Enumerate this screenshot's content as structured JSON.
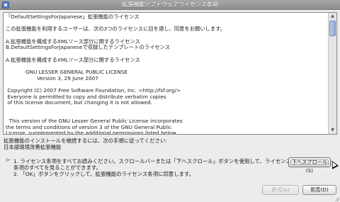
{
  "window": {
    "title": "拡張機能ソフトウェアライセンス条項"
  },
  "license": {
    "text_lines": [
      "「DefaultSettingsForJapanese」拡張機能のライセンス",
      "",
      "この拡張機能を利用するユーザーは、次の3つのライセンスに目を通し、同意をお願いします。",
      "",
      "A.拡張機能を構成するXMLソース部分に関するライセンス",
      "B.DefaultSettingsForJapaneseで収録したテンプレートのライセンス",
      "",
      "A.拡張機能を構成するXMLソース部分に関するライセンス",
      "",
      "            GNU LESSER GENERAL PUBLIC LICENSE",
      "                   Version 3, 29 June 2007",
      "",
      " Copyright (C) 2007 Free Software Foundation, Inc. <http://fsf.org/>",
      " Everyone is permitted to copy and distribute verbatim copies",
      " of this license document, but changing it is not allowed.",
      "",
      "",
      "  This version of the GNU Lesser General Public License incorporates",
      "the terms and conditions of version 3 of the GNU General Public",
      "License, supplemented by the additional permissions listed below."
    ]
  },
  "instructions": {
    "intro": "拡張機能のインストールを継続するには、次の手順に従ってください:",
    "extension_name": "日本語環境改善拡張機能",
    "step1": "1.  ライセンス条項をすべてお読みください。スクロールバーまたは「下へスクロール」ボタンを使用して、ライセンス条項のすべてを見ることができます。",
    "step2": "2.  「OK」ボタンをクリックして、拡張機能のライセンス条項に同意します。"
  },
  "buttons": {
    "scroll_down": "下へスクロール(S)",
    "agree": "許可(A)",
    "decline": "拒否(D)"
  },
  "icons": {
    "step_marker": "arrow-right-icon",
    "scroll_up": "scroll-up-arrow-icon",
    "scroll_down": "scroll-down-arrow-icon"
  }
}
